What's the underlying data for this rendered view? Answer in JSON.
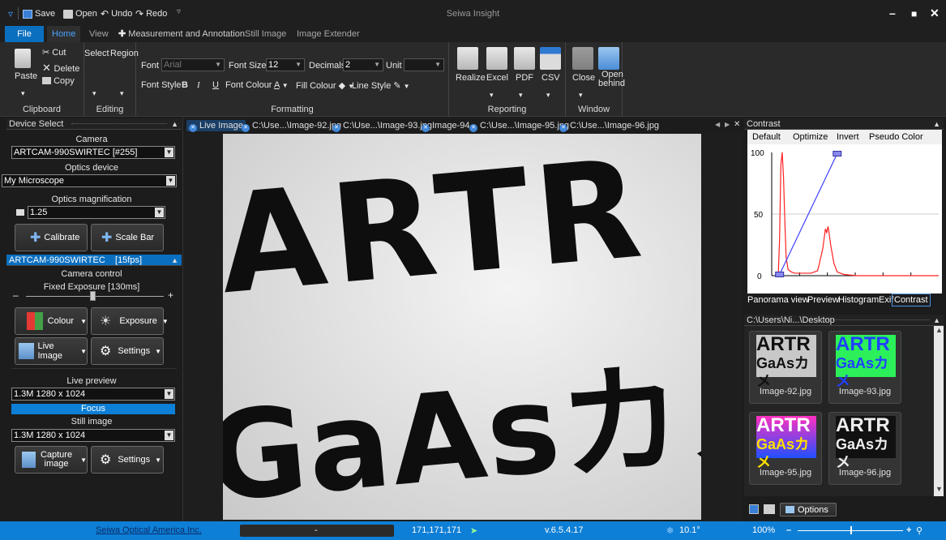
{
  "app": {
    "title": "Seiwa Insight"
  },
  "quick_access": {
    "save": "Save",
    "open": "Open",
    "undo": "Undo",
    "redo": "Redo"
  },
  "ribbon_tabs": [
    "File",
    "Home",
    "View",
    "Measurement and Annotation",
    "Still Image",
    "Image Extender"
  ],
  "ribbon": {
    "clipboard": {
      "paste": "Paste",
      "cut": "Cut",
      "delete": "Delete",
      "copy": "Copy",
      "label": "Clipboard"
    },
    "editing": {
      "select": "Select",
      "region": "Region",
      "label": "Editing"
    },
    "formatting": {
      "font_label": "Font",
      "font_value": "Arial",
      "font_size_label": "Font Size",
      "font_size_value": "12",
      "decimals_label": "Decimals",
      "decimals_value": "2",
      "unit_label": "Unit",
      "unit_value": "",
      "font_style_label": "Font Style",
      "bold": "B",
      "italic": "I",
      "underline": "U",
      "font_colour_label": "Font Colour",
      "fill_colour_label": "Fill Colour",
      "line_style_label": "Line Style",
      "label": "Formatting"
    },
    "reporting": {
      "realize": "Realize",
      "excel": "Excel",
      "pdf": "PDF",
      "csv": "CSV",
      "label": "Reporting"
    },
    "window": {
      "close": "Close",
      "open_behind_1": "Open",
      "open_behind_2": "behind",
      "label": "Window"
    }
  },
  "device_panel": {
    "header": "Device Select",
    "camera_label": "Camera",
    "camera_value": "ARTCAM-990SWIRTEC [#255]",
    "optics_label": "Optics device",
    "optics_value": "My Microscope",
    "magnification_label": "Optics magnification",
    "magnification_value": "1.25",
    "calibrate": "Calibrate",
    "scale_bar": "Scale Bar"
  },
  "camera_panel": {
    "header": "ARTCAM-990SWIRTEC    [15fps]",
    "control_label": "Camera control",
    "exposure_label": "Fixed Exposure [130ms]",
    "exposure_level": 0.48,
    "colour": "Colour",
    "exposure": "Exposure",
    "live_image": "Live Image",
    "settings": "Settings",
    "live_preview_label": "Live preview",
    "live_preview_value": "1.3M 1280 x 1024",
    "focus": "Focus",
    "still_label": "Still image",
    "still_value": "1.3M 1280 x 1024",
    "capture_1": "Capture",
    "capture_2": "image",
    "settings2": "Settings"
  },
  "doc_tabs": [
    "Live Image",
    "C:\\Use...\\Image-92.jpg",
    "C:\\Use...\\Image-93.jpg",
    "Image-94",
    "C:\\Use...\\Image-95.jpg",
    "C:\\Use...\\Image-96.jpg"
  ],
  "viewer": {
    "line1": "ARTR",
    "line2": "GaAsカメ"
  },
  "contrast_panel": {
    "header": "Contrast",
    "tabs": [
      "Default",
      "Optimize",
      "Invert",
      "Pseudo Color"
    ],
    "y_ticks": [
      "100",
      "50",
      "0"
    ],
    "bottom_tabs": [
      "Panorama view",
      "Preview",
      "Histogram",
      "Exif",
      "Contrast"
    ]
  },
  "chart_data": {
    "type": "line",
    "series": [
      {
        "name": "histogram",
        "x": [
          10,
          12,
          14,
          16,
          18,
          20,
          22,
          25,
          30,
          35,
          40,
          45,
          50,
          55,
          60,
          65,
          70,
          72,
          75,
          78,
          80,
          82,
          84,
          86,
          88,
          90,
          95,
          100,
          110,
          130,
          160,
          200,
          255
        ],
        "y": [
          0,
          30,
          90,
          100,
          80,
          45,
          15,
          5,
          3,
          2,
          2,
          2,
          2,
          2,
          2,
          3,
          4,
          8,
          15,
          22,
          30,
          38,
          35,
          40,
          33,
          25,
          10,
          3,
          1,
          0,
          0,
          0,
          0
        ]
      },
      {
        "name": "curve",
        "x": [
          12,
          100
        ],
        "y": [
          1,
          99
        ]
      }
    ],
    "ylim": [
      0,
      100
    ]
  },
  "file_panel": {
    "header": "C:\\Users\\Ni...\\Desktop",
    "thumbs": [
      {
        "label": "Image-92.jpg",
        "l1": "ARTR",
        "l2": "GaAsカメ"
      },
      {
        "label": "Image-93.jpg",
        "l1": "ARTR",
        "l2": "GaAsカメ"
      },
      {
        "label": "Image-95.jpg",
        "l1": "ARTR",
        "l2": "GaAsカメ"
      },
      {
        "label": "Image-96.jpg",
        "l1": "ARTR",
        "l2": "GaAsカメ"
      }
    ],
    "options": "Options"
  },
  "status": {
    "company": "Seiwa Optical America Inc.",
    "dash": "-",
    "rgb": "171,171,171",
    "version": "v.6.5.4.17",
    "temp": "10.1°",
    "zoom": "100%",
    "zoom_level": 0.5
  },
  "colors": {
    "accent": "#0e7fd6",
    "histogram": "#ff2020",
    "curve": "#4040ff"
  }
}
